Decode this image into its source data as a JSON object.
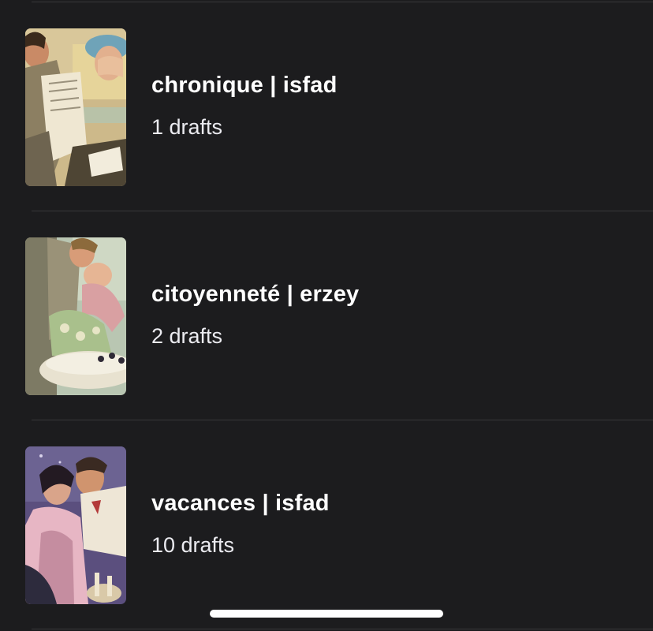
{
  "stories": [
    {
      "title": "chronique | isfad",
      "drafts": "1 drafts",
      "cover_icon": "vintage-couple-reading-illustration"
    },
    {
      "title": "citoyenneté | erzey",
      "drafts": "2 drafts",
      "cover_icon": "vintage-embrace-illustration"
    },
    {
      "title": "vacances | isfad",
      "drafts": "10 drafts",
      "cover_icon": "vintage-kiss-night-illustration"
    }
  ],
  "colors": {
    "background": "#1c1c1e",
    "divider": "#38383a",
    "title": "#ffffff",
    "subtitle": "#ebebf0"
  }
}
